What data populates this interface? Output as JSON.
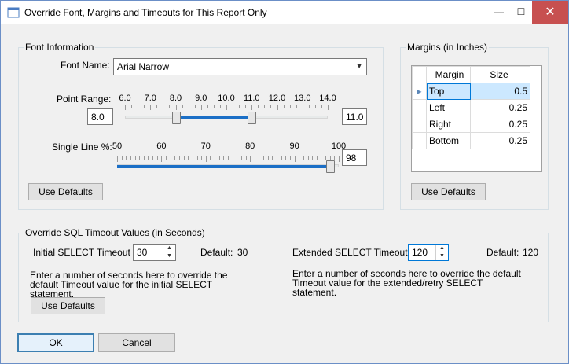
{
  "window": {
    "title": "Override Font, Margins and Timeouts for This Report Only",
    "close_glyph": "✕",
    "min_glyph": "—",
    "max_glyph": "☐"
  },
  "font_info": {
    "group_title": "Font Information",
    "font_name_label": "Font Name:",
    "font_name_value": "Arial Narrow",
    "point_range_label": "Point Range:",
    "point_min_value": "8.0",
    "point_max_value": "11.0",
    "point_ticks": [
      "6.0",
      "7.0",
      "8.0",
      "9.0",
      "10.0",
      "11.0",
      "12.0",
      "13.0",
      "14.0"
    ],
    "point_low_fraction": 0.25,
    "point_high_fraction": 0.625,
    "single_line_label": "Single Line %:",
    "single_line_ticks": [
      "50",
      "60",
      "70",
      "80",
      "90",
      "100"
    ],
    "single_line_value": "98",
    "single_line_fraction": 0.96,
    "use_defaults_label": "Use Defaults"
  },
  "margins": {
    "group_title": "Margins (in Inches)",
    "columns": [
      "Margin",
      "Size"
    ],
    "rows": [
      {
        "margin": "Top",
        "size": "0.5"
      },
      {
        "margin": "Left",
        "size": "0.25"
      },
      {
        "margin": "Right",
        "size": "0.25"
      },
      {
        "margin": "Bottom",
        "size": "0.25"
      }
    ],
    "row_indicator": "▶",
    "use_defaults_label": "Use Defaults"
  },
  "sql_timeout": {
    "group_title": "Override SQL Timeout Values (in Seconds)",
    "initial_label": "Initial SELECT Timeout",
    "initial_value": "30",
    "initial_default_label": "Default:",
    "initial_default_value": "30",
    "initial_help": "Enter a number of seconds here to override the default Timeout value for the initial SELECT statement.",
    "extended_label": "Extended SELECT Timeout",
    "extended_value": "120",
    "extended_default_label": "Default:",
    "extended_default_value": "120",
    "extended_help": "Enter a number of seconds here to override the default Timeout value for the extended/retry SELECT statement.",
    "use_defaults_label": "Use Defaults"
  },
  "footer": {
    "ok_label": "OK",
    "cancel_label": "Cancel"
  },
  "colors": {
    "accent": "#1b6fc6",
    "selection": "#cce8ff",
    "close_button": "#c75050"
  }
}
